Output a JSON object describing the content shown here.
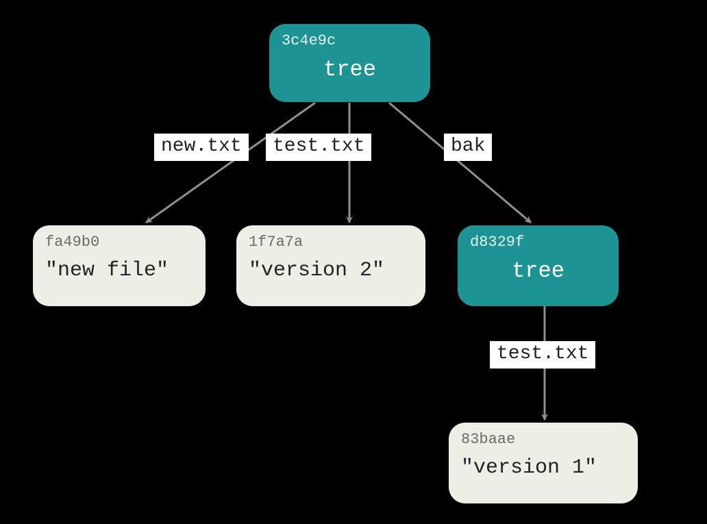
{
  "colors": {
    "background": "#000000",
    "tree_fill": "#1d9393",
    "blob_fill": "#edeee6",
    "arrow": "#8f8f8f",
    "label_bg": "#ffffff"
  },
  "nodes": {
    "root_tree": {
      "hash": "3c4e9c",
      "label": "tree",
      "kind": "tree"
    },
    "blob_new": {
      "hash": "fa49b0",
      "label": "\"new file\"",
      "kind": "blob"
    },
    "blob_v2": {
      "hash": "1f7a7a",
      "label": "\"version 2\"",
      "kind": "blob"
    },
    "sub_tree": {
      "hash": "d8329f",
      "label": "tree",
      "kind": "tree"
    },
    "blob_v1": {
      "hash": "83baae",
      "label": "\"version 1\"",
      "kind": "blob"
    }
  },
  "edges": {
    "root_to_new": {
      "from": "root_tree",
      "to": "blob_new",
      "label": "new.txt"
    },
    "root_to_v2": {
      "from": "root_tree",
      "to": "blob_v2",
      "label": "test.txt"
    },
    "root_to_sub": {
      "from": "root_tree",
      "to": "sub_tree",
      "label": "bak"
    },
    "sub_to_v1": {
      "from": "sub_tree",
      "to": "blob_v1",
      "label": "test.txt"
    }
  }
}
